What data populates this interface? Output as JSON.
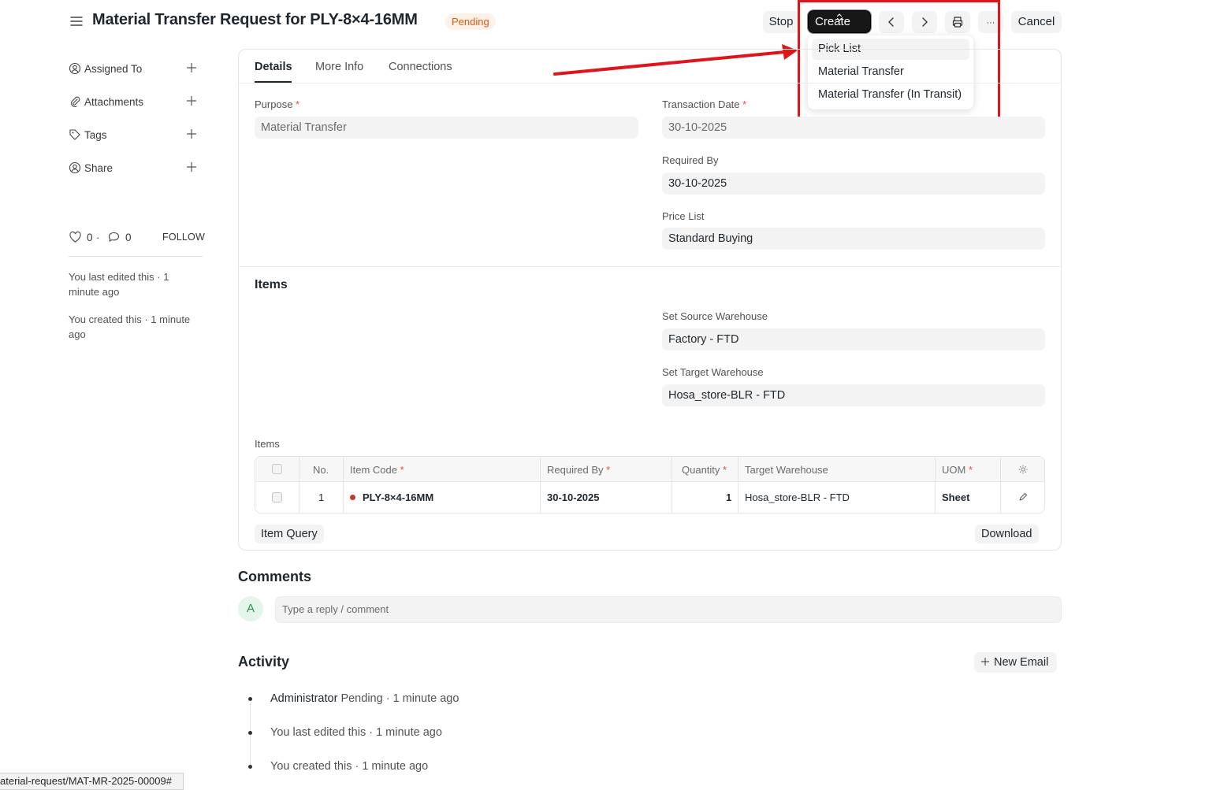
{
  "header": {
    "title": "Material Transfer Request for PLY-8×4-16MM",
    "status": "Pending",
    "stop_label": "Stop",
    "create_label": "Create",
    "cancel_label": "Cancel",
    "more_label": "···"
  },
  "create_menu": {
    "items": [
      "Pick List",
      "Material Transfer",
      "Material Transfer (In Transit)"
    ],
    "active_index": 0
  },
  "sidebar": {
    "items": [
      {
        "label": "Assigned To",
        "icon": "user-assign-icon"
      },
      {
        "label": "Attachments",
        "icon": "paperclip-icon"
      },
      {
        "label": "Tags",
        "icon": "tag-icon"
      },
      {
        "label": "Share",
        "icon": "share-user-icon"
      }
    ],
    "likes": "0",
    "comments": "0",
    "follow_label": "FOLLOW",
    "last_edited": "You last edited this · 1 minute ago",
    "created": "You created this · 1 minute ago"
  },
  "tabs": [
    "Details",
    "More Info",
    "Connections"
  ],
  "details": {
    "purpose_label": "Purpose",
    "purpose_value": "Material Transfer",
    "transaction_date_label": "Transaction Date",
    "transaction_date_value": "30-10-2025",
    "required_by_label": "Required By",
    "required_by_value": "30-10-2025",
    "price_list_label": "Price List",
    "price_list_value": "Standard Buying"
  },
  "items_section": {
    "title": "Items",
    "source_wh_label": "Set Source Warehouse",
    "source_wh_value": "Factory - FTD",
    "target_wh_label": "Set Target Warehouse",
    "target_wh_value": "Hosa_store-BLR - FTD",
    "table_label": "Items",
    "columns": [
      "No.",
      "Item Code",
      "Required By",
      "Quantity",
      "Target Warehouse",
      "UOM"
    ],
    "rows": [
      {
        "no": "1",
        "item_code": "PLY-8×4-16MM",
        "required_by": "30-10-2025",
        "quantity": "1",
        "target_warehouse": "Hosa_store-BLR - FTD",
        "uom": "Sheet"
      }
    ],
    "item_query_label": "Item Query",
    "download_label": "Download"
  },
  "comments": {
    "title": "Comments",
    "avatar_letter": "A",
    "placeholder": "Type a reply / comment"
  },
  "activity": {
    "title": "Activity",
    "new_email_label": "New Email",
    "entries": [
      {
        "actor": "Administrator",
        "text": " Pending · 1 minute ago"
      },
      {
        "actor": "",
        "text": "You last edited this · 1 minute ago"
      },
      {
        "actor": "",
        "text": "You created this · 1 minute ago"
      }
    ]
  },
  "status_bar": {
    "url": "aterial-request/MAT-MR-2025-00009#"
  },
  "colors": {
    "annotation_red": "#e0141b",
    "status_orange": "#d45b16",
    "primary_dark": "#171717"
  }
}
